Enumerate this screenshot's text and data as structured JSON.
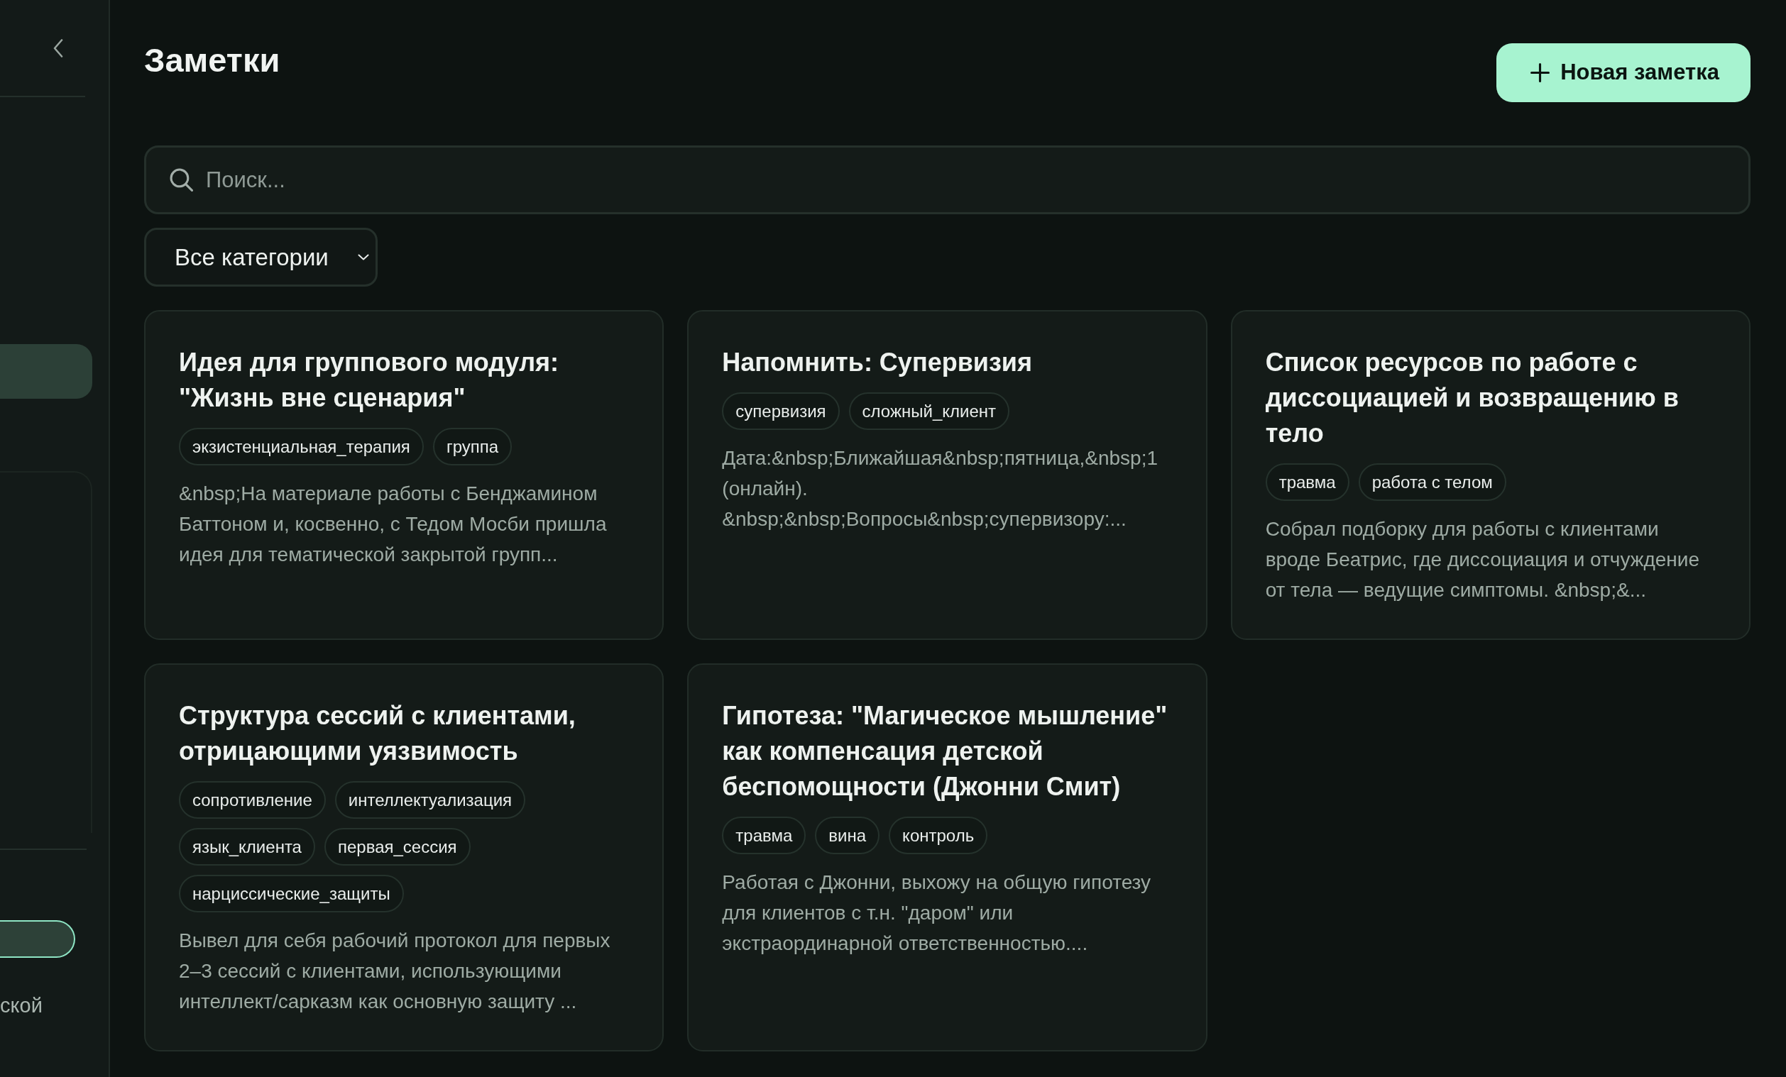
{
  "sidebar": {
    "nav_items": [
      {
        "selected": true
      }
    ],
    "footer_text": "ской"
  },
  "header": {
    "title": "Заметки",
    "new_note_button": "Новая заметка"
  },
  "search": {
    "placeholder": "Поиск..."
  },
  "category_filter": {
    "value": "Все категории"
  },
  "notes": [
    {
      "title": "Идея для группового модуля: \"Жизнь вне сценария\"",
      "tags": [
        "экзистенциальная_терапия",
        "группа"
      ],
      "preview": "&nbsp;На материале работы с Бенджамином Баттоном и, косвенно, с Тедом Мосби пришла идея для тематической закрытой групп..."
    },
    {
      "title": "Напомнить: Супервизия",
      "tags": [
        "супервизия",
        "сложный_клиент"
      ],
      "preview": "Дата:&nbsp;Ближайшая&nbsp;пятница,&nbsp;1 (онлайн). &nbsp;&nbsp;Вопросы&nbsp;супервизору:..."
    },
    {
      "title": "Список ресурсов по работе с диссоциацией и возвращению в тело",
      "tags": [
        "травма",
        "работа с телом"
      ],
      "preview": "Собрал подборку для работы с клиентами вроде Беатрис, где диссоциация и отчуждение от тела — ведущие симптомы. &nbsp;&..."
    },
    {
      "title": "Структура сессий с клиентами, отрицающими уязвимость",
      "tags": [
        "сопротивление",
        "интеллектуализация",
        "язык_клиента",
        "первая_сессия",
        "нарциссические_защиты"
      ],
      "preview": "Вывел для себя рабочий протокол для первых 2–3 сессий с клиентами, использующими интеллект/сарказм как основную защиту ..."
    },
    {
      "title": "Гипотеза: \"Магическое мышление\" как компенсация детской беспомощности (Джонни Смит)",
      "tags": [
        "травма",
        "вина",
        "контроль"
      ],
      "preview": "Работая с Джонни, выхожу на общую гипотезу для клиентов с т.н. \"даром\" или экстраординарной ответственностью...."
    }
  ]
}
